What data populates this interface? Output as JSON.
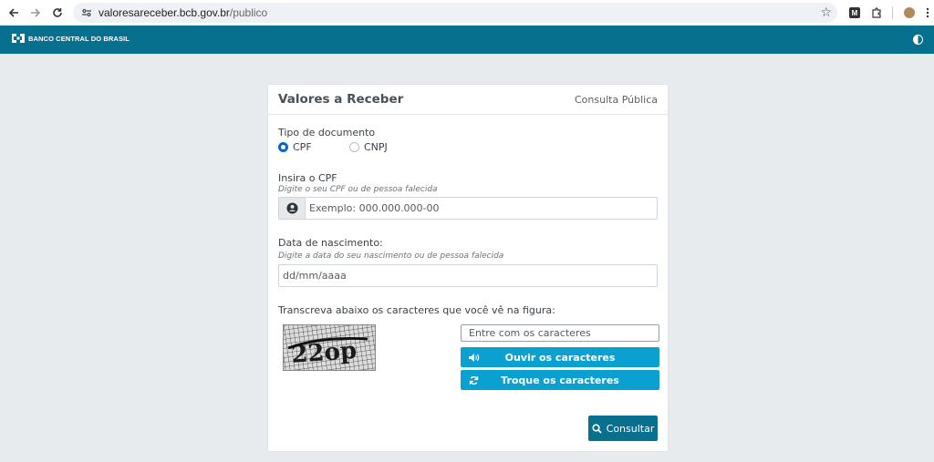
{
  "browser": {
    "url_host": "valoresareceber.bcb.gov.br",
    "url_path": "/publico"
  },
  "header": {
    "logo_text": "BANCO CENTRAL DO BRASIL"
  },
  "card": {
    "title": "Valores a Receber",
    "subtitle": "Consulta Pública"
  },
  "form": {
    "doc_type_label": "Tipo de documento",
    "options": [
      "CPF",
      "CNPJ"
    ],
    "selected_option": "CPF",
    "cpf_label": "Insira o CPF",
    "cpf_hint": "Digite o seu CPF ou de pessoa falecida",
    "cpf_placeholder": "Exemplo: 000.000.000-00",
    "dob_label": "Data de nascimento:",
    "dob_hint": "Digite a data do seu nascimento ou de pessoa falecida",
    "dob_placeholder": "dd/mm/aaaa",
    "captcha_label": "Transcreva abaixo os caracteres que você vê na figura:",
    "captcha_text": "22op",
    "captcha_placeholder": "Entre com os caracteres",
    "listen_button": "Ouvir os caracteres",
    "swap_button": "Troque os caracteres",
    "submit_button": "Consultar"
  },
  "colors": {
    "header_bg": "#08708f",
    "button_bg": "#0aa0d0",
    "submit_bg": "#08708f",
    "radio_checked": "#0a67c7"
  },
  "icons": {
    "back": "arrow-left-icon",
    "forward": "arrow-right-icon",
    "reload": "reload-icon",
    "bookmark": "star-icon",
    "user": "user-circle-icon",
    "speaker": "speaker-icon",
    "refresh": "refresh-icon",
    "search": "search-icon",
    "contrast": "contrast-icon"
  }
}
